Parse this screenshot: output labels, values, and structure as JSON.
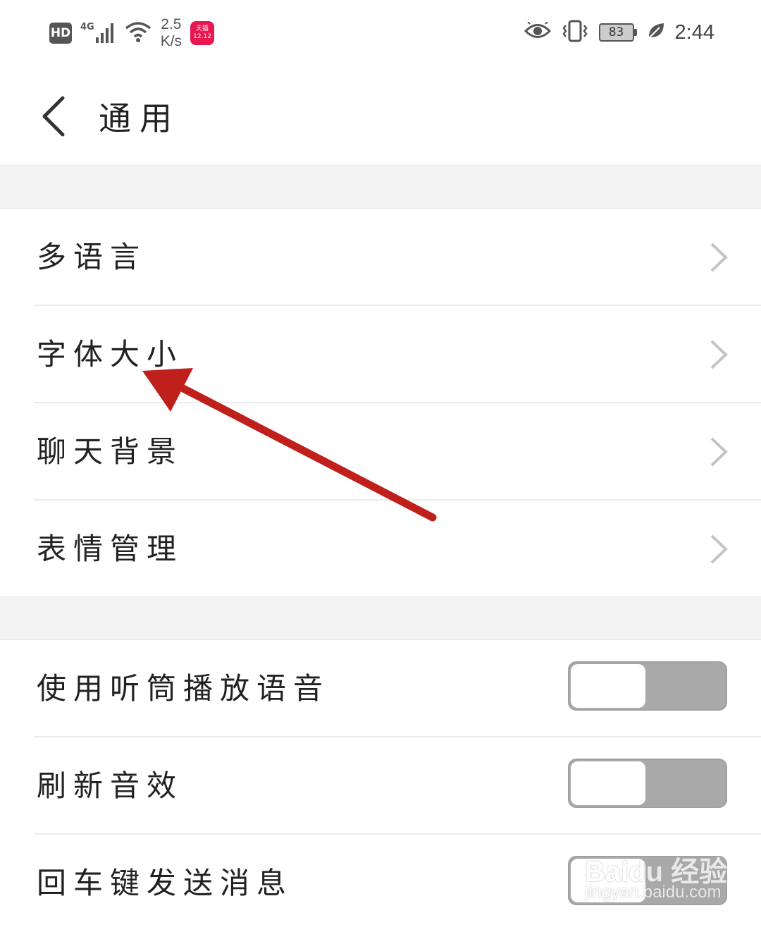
{
  "status_bar": {
    "hd": "HD",
    "network": "4G",
    "speed_value": "2.5",
    "speed_unit": "K/s",
    "app_badge_top": "天猫",
    "app_badge_bottom": "12.12",
    "battery": "83",
    "time": "2:44"
  },
  "header": {
    "title": "通用"
  },
  "section1": {
    "items": [
      {
        "label": "多语言"
      },
      {
        "label": "字体大小"
      },
      {
        "label": "聊天背景"
      },
      {
        "label": "表情管理"
      }
    ]
  },
  "section2": {
    "items": [
      {
        "label": "使用听筒播放语音",
        "toggle_on": false
      },
      {
        "label": "刷新音效",
        "toggle_on": false
      },
      {
        "label": "回车键发送消息",
        "toggle_on": false
      }
    ]
  },
  "watermark": {
    "brand": "Baidu 经验",
    "site": "jingyan.baidu.com"
  },
  "colors": {
    "annotation_arrow": "#c0201c",
    "toggle_off": "#a9a9a9",
    "section_gap": "#f3f3f3"
  }
}
